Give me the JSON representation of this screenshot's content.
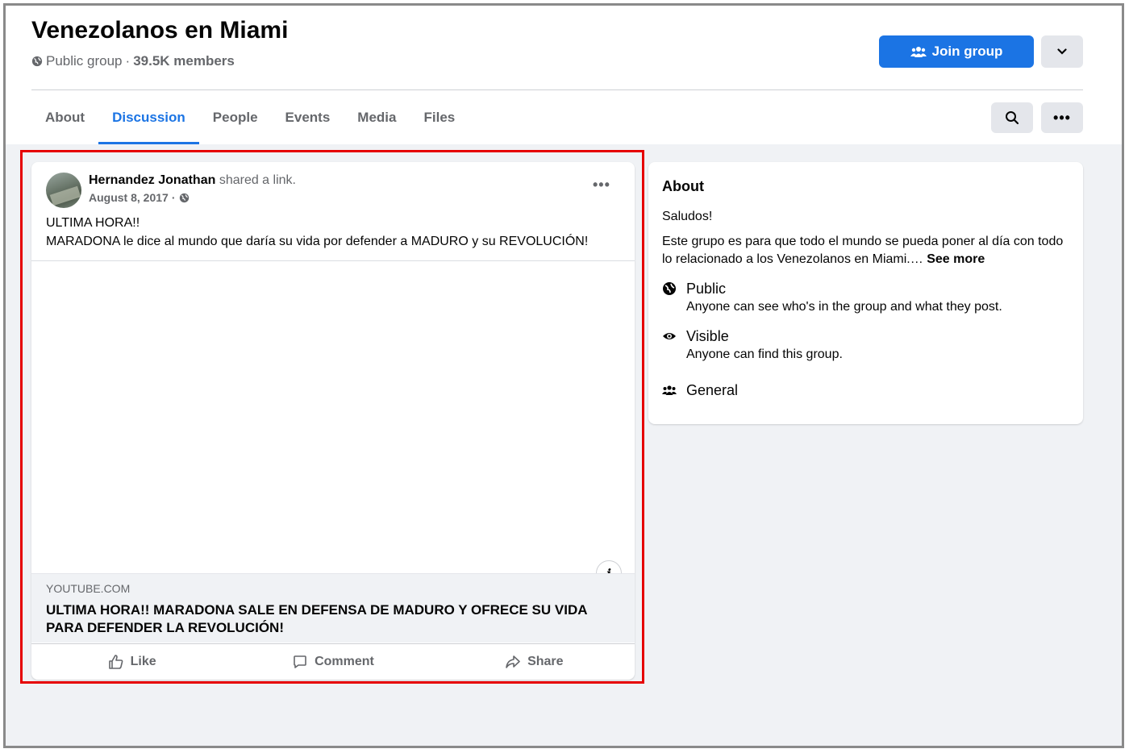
{
  "group": {
    "title": "Venezolanos en Miami",
    "privacy": "Public group",
    "separator": "·",
    "members": "39.5K members",
    "join_label": "Join group"
  },
  "tabs": [
    {
      "label": "About"
    },
    {
      "label": "Discussion",
      "active": true
    },
    {
      "label": "People"
    },
    {
      "label": "Events"
    },
    {
      "label": "Media"
    },
    {
      "label": "Files"
    }
  ],
  "post": {
    "author": "Hernandez Jonathan",
    "action": "shared a link.",
    "date": "August 8, 2017",
    "date_sep": "·",
    "text_line1": "ULTIMA HORA!!",
    "text_line2": "MARADONA le dice al mundo que daría su vida por defender a MADURO y su REVOLUCIÓN!",
    "link_domain": "YOUTUBE.COM",
    "link_title": "ULTIMA HORA!! MARADONA SALE EN DEFENSA DE MADURO Y OFRECE SU VIDA PARA DEFENDER LA REVOLUCIÓN!",
    "info_glyph": "i",
    "more_glyph": "•••"
  },
  "actions": {
    "like": "Like",
    "comment": "Comment",
    "share": "Share"
  },
  "about": {
    "title": "About",
    "greeting": "Saludos!",
    "description": "Este grupo es para que todo el mundo se pueda poner al día con todo lo relacionado a los Venezolanos en Miami.…",
    "see_more": "See more",
    "public_title": "Public",
    "public_sub": "Anyone can see who's in the group and what they post.",
    "visible_title": "Visible",
    "visible_sub": "Anyone can find this group.",
    "general_title": "General"
  },
  "colors": {
    "accent": "#1b74e4",
    "highlight": "#e60000",
    "background": "#f0f2f5"
  }
}
